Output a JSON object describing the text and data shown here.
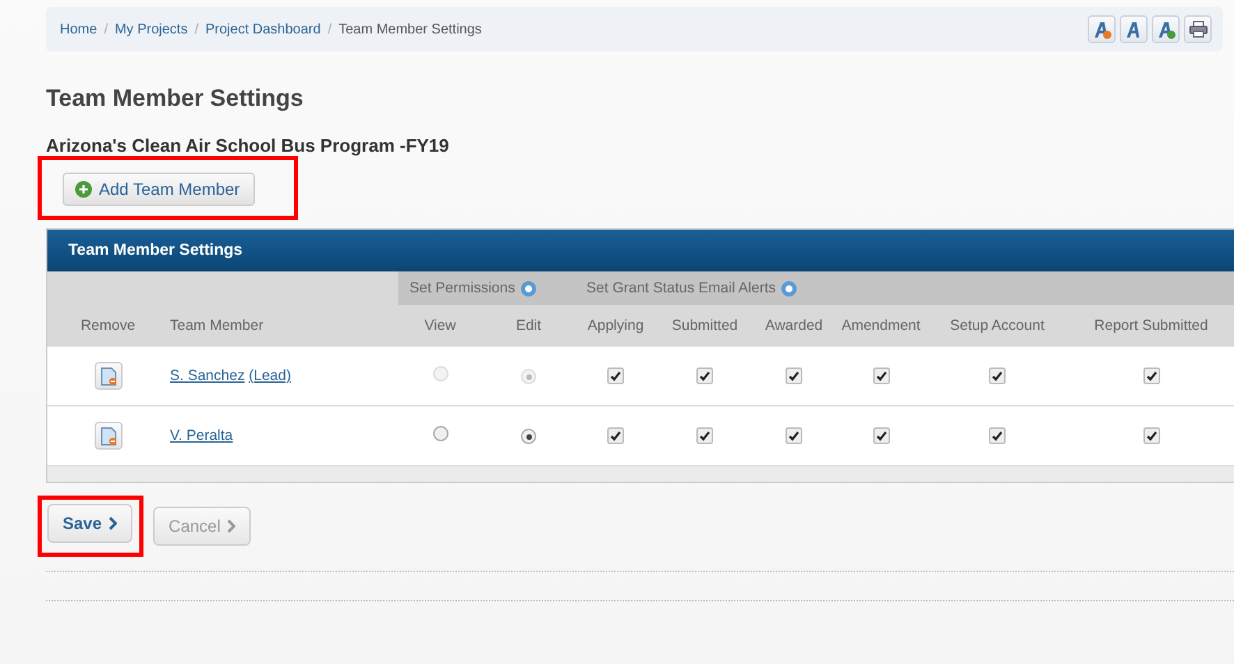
{
  "breadcrumb": [
    {
      "label": "Home",
      "link": true
    },
    {
      "label": "My Projects",
      "link": true
    },
    {
      "label": "Project Dashboard",
      "link": true
    },
    {
      "label": "Team Member Settings",
      "link": false
    }
  ],
  "breadcrumb_separator": "/",
  "toolbar": [
    {
      "kind": "font-decrease"
    },
    {
      "kind": "font-normal"
    },
    {
      "kind": "font-increase"
    },
    {
      "kind": "print"
    }
  ],
  "title": "Team Member Settings",
  "subtitle": "Arizona's Clean Air School Bus Program -FY19",
  "add_button": {
    "label": "Add Team Member",
    "highlighted": true
  },
  "panel": {
    "title": "Team Member Settings",
    "columns": [
      "Remove",
      "Team Member"
    ],
    "groups": [
      {
        "label": "Set Permissions",
        "columns": [
          "View",
          "Edit"
        ]
      },
      {
        "label": "Set Grant Status Email Alerts",
        "columns": [
          "Applying",
          "Submitted",
          "Awarded",
          "Amendment",
          "Setup Account",
          "Report Submitted"
        ]
      }
    ],
    "rows": [
      {
        "name": "S. Sanchez",
        "role": "(Lead)",
        "disabled": true,
        "permissions": [
          {
            "selected": false
          },
          {
            "selected": true
          }
        ],
        "alerts": [
          {
            "checked": true
          },
          {
            "checked": true
          },
          {
            "checked": true
          },
          {
            "checked": true
          },
          {
            "checked": true
          },
          {
            "checked": true
          }
        ]
      },
      {
        "name": "V. Peralta",
        "disabled": false,
        "permissions": [
          {
            "selected": false
          },
          {
            "selected": true
          }
        ],
        "alerts": [
          {
            "checked": true
          },
          {
            "checked": true
          },
          {
            "checked": true
          },
          {
            "checked": true
          },
          {
            "checked": true
          },
          {
            "checked": true
          }
        ]
      }
    ]
  },
  "buttons": [
    {
      "label": "Save",
      "kind": "primary",
      "highlighted": true
    },
    {
      "label": "Cancel",
      "kind": "secondary",
      "highlighted": false
    }
  ]
}
